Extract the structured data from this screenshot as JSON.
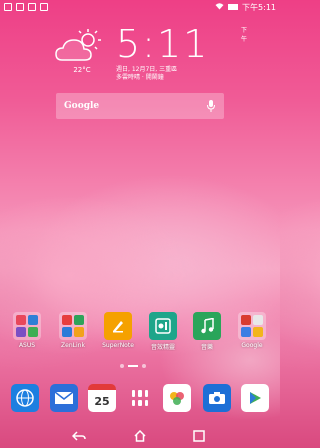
{
  "status_bar": {
    "right_time": "下午5:11"
  },
  "clock_widget": {
    "time": "5:11",
    "ampm": "下午",
    "date": "週日, 12月7日, 三重區",
    "city": "多雲時晴 · 開鬧鐘",
    "temperature": "22°C"
  },
  "search": {
    "label": "Google"
  },
  "apps": [
    {
      "label": "ASUS"
    },
    {
      "label": "ZenLink"
    },
    {
      "label": "SuperNote"
    },
    {
      "label": "音效精靈"
    },
    {
      "label": "音樂"
    },
    {
      "label": "Google"
    }
  ],
  "dock": {
    "calendar_day": "25"
  },
  "colors": {
    "accent": "#ee3f86"
  }
}
